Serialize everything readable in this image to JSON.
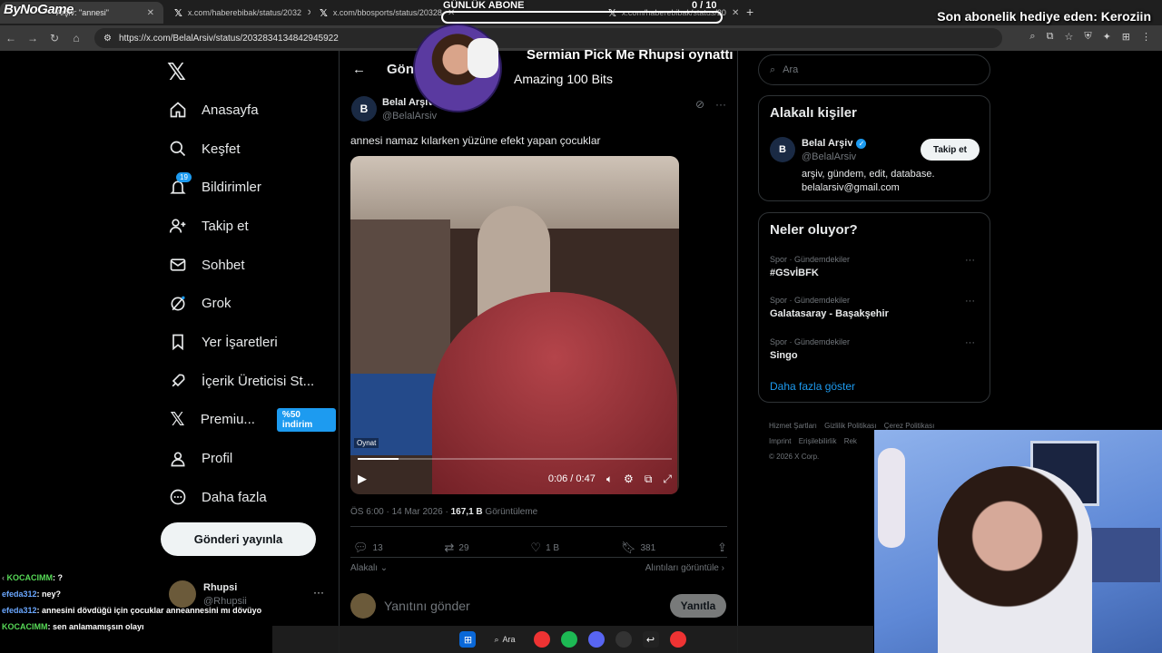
{
  "browser": {
    "tabs": [
      {
        "label": "Arşiv: \"annesi\"",
        "active": true
      },
      {
        "label": "x.com/haberebibak/status/2032",
        "active": false
      },
      {
        "label": "x.com/bbosports/status/20328",
        "active": false
      },
      {
        "label": "x.com/haberebibak/status/20",
        "active": false
      }
    ],
    "url": "https://x.com/BelalArsiv/status/2032834134842945922"
  },
  "overlay": {
    "logo": "ByNoGame",
    "goal_label": "GÜNLÜK ABONE",
    "goal_count": "0 / 10",
    "sub_gift": "Son abonelik hediye eden: Keroziin",
    "alert_title": "Sermian Pick Me Rhupsi oynattı",
    "alert_sub": "Amazing 100 Bits"
  },
  "nav": {
    "items": [
      {
        "label": "Anasayfa",
        "icon": "home-icon"
      },
      {
        "label": "Keşfet",
        "icon": "search-icon"
      },
      {
        "label": "Bildirimler",
        "icon": "bell-icon",
        "badge": "19"
      },
      {
        "label": "Takip et",
        "icon": "follow-icon"
      },
      {
        "label": "Sohbet",
        "icon": "mail-icon"
      },
      {
        "label": "Grok",
        "icon": "grok-icon"
      },
      {
        "label": "Yer İşaretleri",
        "icon": "bookmark-icon"
      },
      {
        "label": "İçerik Üreticisi St...",
        "icon": "rocket-icon"
      },
      {
        "label": "Premiu...",
        "icon": "x-icon",
        "badge": "%50 indirim"
      },
      {
        "label": "Profil",
        "icon": "profile-icon"
      },
      {
        "label": "Daha fazla",
        "icon": "more-icon"
      }
    ],
    "post_button": "Gönderi yayınla",
    "account_name": "Rhupsi",
    "account_handle": "@Rhupsii"
  },
  "main": {
    "header": "Gönderi",
    "author_name": "Belal Arşiv",
    "author_handle": "@BelalArsiv",
    "post_text": "annesi namaz kılarken yüzüne efekt yapan çocuklar",
    "video_label": "Oynat",
    "video_time": "0:06 / 0:47",
    "video_progress": 0.13,
    "meta_time": "ÖS 6:00 · 14 Mar 2026 · ",
    "meta_views": "167,1 B",
    "meta_views_label": " Görüntüleme",
    "replies": "13",
    "reposts": "29",
    "likes": "1 B",
    "bookmarks": "381",
    "relevant": "Alakalı",
    "quotes_link": "Alıntıları görüntüle",
    "reply_placeholder": "Yanıtını gönder",
    "reply_button": "Yanıtla"
  },
  "sidebar": {
    "search_placeholder": "Ara",
    "who_title": "Alakalı kişiler",
    "who_name": "Belal Arşiv",
    "who_handle": "@BelalArsiv",
    "who_bio_1": "arşiv, gündem, edit, database.",
    "who_bio_2": "belalarsiv@gmail.com",
    "follow_button": "Takip et",
    "trends_title": "Neler oluyor?",
    "trends": [
      {
        "category": "Spor · Gündemdekiler",
        "name": "#GSvİBFK"
      },
      {
        "category": "Spor · Gündemdekiler",
        "name": "Galatasaray - Başakşehir"
      },
      {
        "category": "Spor · Gündemdekiler",
        "name": "Singo"
      }
    ],
    "show_more": "Daha fazla göster",
    "footer": [
      "Hizmet Şartları",
      "Gizlilik Politikası",
      "Çerez Politikası",
      "Imprint",
      "Erişilebilirlik",
      "Rek",
      "© 2026 X Corp."
    ]
  },
  "chat": [
    {
      "user": "KOCACIMM",
      "text": ": ?"
    },
    {
      "user": "efeda312",
      "text": ": ney?"
    },
    {
      "user": "efeda312",
      "text": ": annesini dövdüğü için çocuklar anneannesini mı dövüyo"
    },
    {
      "user": "KOCACIMM",
      "text": ": sen anlamamışsın olayı"
    }
  ],
  "taskbar": {
    "search_label": "Ara"
  }
}
